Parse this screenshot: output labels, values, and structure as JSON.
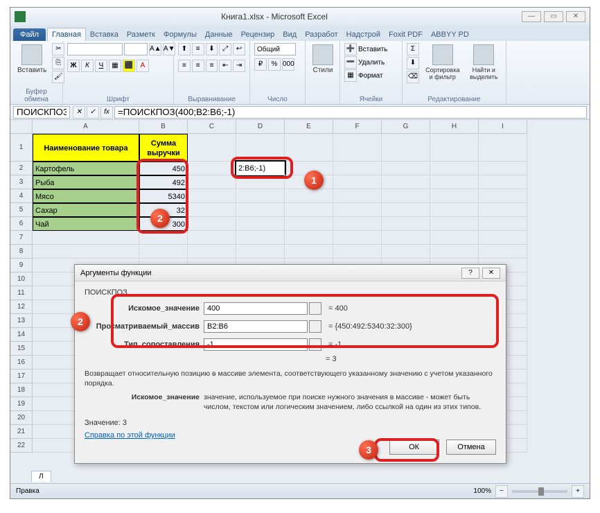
{
  "window": {
    "title": "Книга1.xlsx - Microsoft Excel"
  },
  "tabs": {
    "file": "Файл",
    "home": "Главная",
    "insert": "Вставка",
    "pagelayout": "Разметк",
    "formulas": "Формулы",
    "data": "Данные",
    "review": "Рецензир",
    "view": "Вид",
    "developer": "Разработ",
    "addins": "Надстрой",
    "foxit": "Foxit PDF",
    "abbyy": "ABBYY PD"
  },
  "ribbon": {
    "paste": "Вставить",
    "clipboard": "Буфер обмена",
    "font": "Шрифт",
    "align": "Выравнивание",
    "number": "Число",
    "general": "Общий",
    "styles": "Стили",
    "cells_insert": "Вставить",
    "cells_delete": "Удалить",
    "cells_format": "Формат",
    "cells": "Ячейки",
    "sort": "Сортировка и фильтр",
    "find": "Найти и выделить",
    "editing": "Редактирование"
  },
  "formulabar": {
    "namebox": "ПОИСКПОЗ",
    "formula": "=ПОИСКПОЗ(400;B2:B6;-1)"
  },
  "columns": [
    "A",
    "B",
    "C",
    "D",
    "E",
    "F",
    "G",
    "H",
    "I"
  ],
  "rows": [
    "1",
    "2",
    "3",
    "4",
    "5",
    "6",
    "7",
    "8",
    "9",
    "10",
    "11",
    "12",
    "13",
    "14",
    "15",
    "16",
    "17",
    "18",
    "19",
    "20",
    "21",
    "22"
  ],
  "sheet": {
    "h1": "Наименование товара",
    "h2a": "Сумма",
    "h2b": "выручки",
    "d2_display": "2:B6;-1)",
    "rows": [
      {
        "name": "Картофель",
        "val": "450"
      },
      {
        "name": "Рыба",
        "val": "492"
      },
      {
        "name": "Мясо",
        "val": "5340"
      },
      {
        "name": "Сахар",
        "val": "32"
      },
      {
        "name": "Чай",
        "val": "300"
      }
    ]
  },
  "dialog": {
    "title": "Аргументы функции",
    "func": "ПОИСКПОЗ",
    "arg1_label": "Искомое_значение",
    "arg1_val": "400",
    "arg1_res": "=  400",
    "arg2_label": "Просматриваемый_массив",
    "arg2_val": "B2:B6",
    "arg2_res": "=  {450:492:5340:32:300}",
    "arg3_label": "Тип_сопоставления",
    "arg3_val": "-1",
    "arg3_res": "=  -1",
    "func_res": "=  3",
    "desc1": "Возвращает относительную позицию в массиве элемента, соответствующего указанному значению с учетом указанного порядка.",
    "desc2_label": "Искомое_значение",
    "desc2": "значение, используемое при поиске нужного значения в массиве - может быть числом, текстом или логическим значением, либо ссылкой на один из этих типов.",
    "value_label": "Значение:  3",
    "help": "Справка по этой функции",
    "ok": "ОК",
    "cancel": "Отмена"
  },
  "status": {
    "mode": "Правка",
    "sheet": "Л",
    "zoom": "100%"
  }
}
